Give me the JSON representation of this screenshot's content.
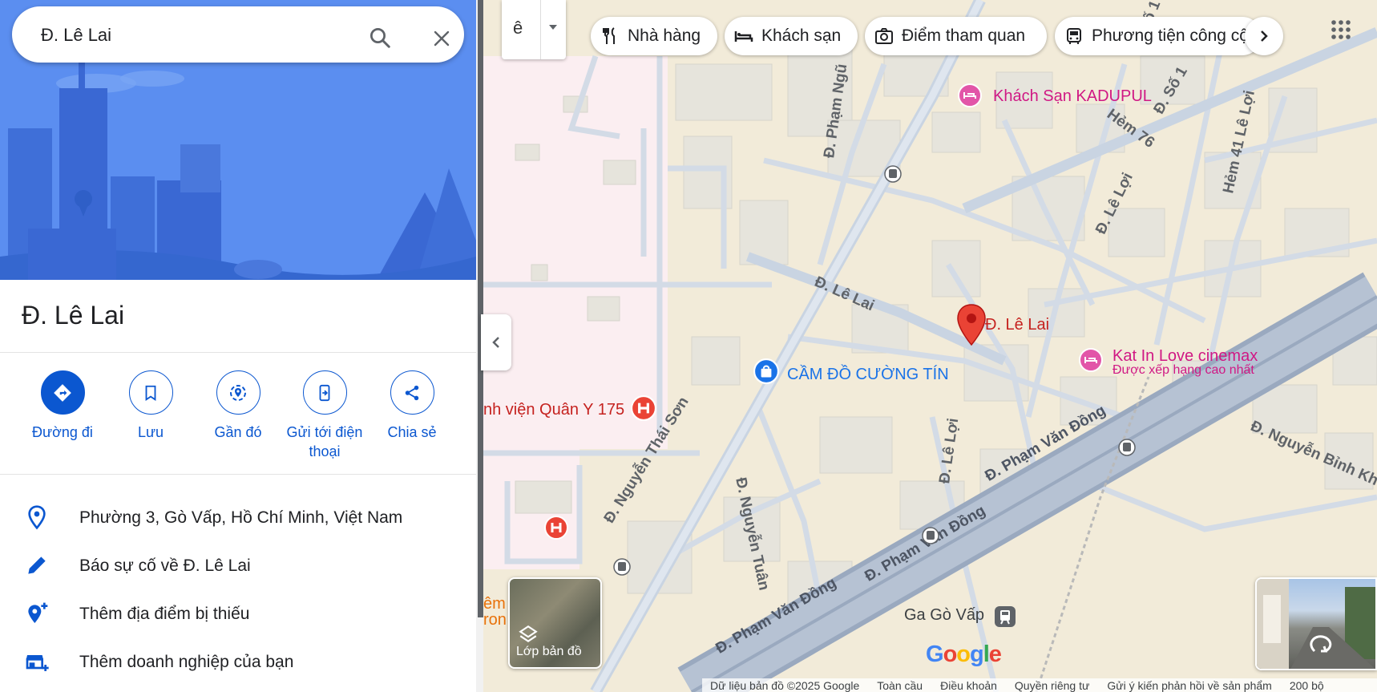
{
  "search": {
    "query": "Đ. Lê Lai"
  },
  "place": {
    "title": "Đ. Lê Lai",
    "actions": [
      {
        "label": "Đường đi",
        "icon": "directions-icon"
      },
      {
        "label": "Lưu",
        "icon": "bookmark-icon"
      },
      {
        "label": "Gần đó",
        "icon": "nearby-icon"
      },
      {
        "label": "Gửi tới điện thoại",
        "icon": "send-to-phone-icon"
      },
      {
        "label": "Chia sẻ",
        "icon": "share-icon"
      }
    ],
    "info": [
      {
        "text": "Phường 3, Gò Vấp, Hồ Chí Minh, Việt Nam",
        "icon": "location-pin-icon"
      },
      {
        "text": "Báo sự cố về Đ. Lê Lai",
        "icon": "edit-pencil-icon"
      },
      {
        "text": "Thêm địa điểm bị thiếu",
        "icon": "add-place-icon"
      },
      {
        "text": "Thêm doanh nghiệp của bạn",
        "icon": "add-business-icon"
      }
    ]
  },
  "map": {
    "transit_glyph": "ê",
    "chips": [
      {
        "label": "Nhà hàng",
        "icon": "restaurant-icon"
      },
      {
        "label": "Khách sạn",
        "icon": "hotel-icon"
      },
      {
        "label": "Điểm tham quan",
        "icon": "camera-icon"
      },
      {
        "label": "Phương tiện công cộng",
        "icon": "bus-icon"
      }
    ],
    "streets": {
      "le_lai_upper": "Đ. Lê Lai",
      "le_loi_upper": "Đ. Lê Lợi",
      "le_loi_lower": "Đ. Lê Lợi",
      "so1": "Đ. Số 1",
      "hem76": "Hẻm 76",
      "hem41": "Hẻm 41 Lê Lợi",
      "pham_ngu": "Đ. Phạm Ngũ",
      "nguyen_thai_son": "Đ. Nguyễn Thái Sơn",
      "nguyen_tuan": "Đ. Nguyễn Tuân",
      "pvd1": "Đ. Phạm Văn Đồng",
      "pvd2": "Đ. Phạm Văn Đồng",
      "pvd3": "Đ. Phạm Văn Đồng",
      "nguyen_binh_khiem": "Đ. Nguyễn Bỉnh Kh",
      "so_top": "Số 1"
    },
    "pois": {
      "selected": "Đ. Lê Lai",
      "khach_san": "Khách Sạn KADUPUL",
      "cinema": "Kat In Love cinemax",
      "cinema_sub": "Được xếp hạng cao nhất",
      "cam_do": "CẦM ĐỒ CƯỜNG TÍN",
      "hospital": "nh viện Quân Y 175",
      "station": "Ga Gò Vấp",
      "edge1": "êm",
      "edge2": "ron"
    },
    "layers_label": "Lớp bản đồ",
    "logo": "Google",
    "footer": {
      "data": "Dữ liệu bản đồ ©2025 Google",
      "global": "Toàn cầu",
      "terms": "Điều khoản",
      "privacy": "Quyền riêng tư",
      "feedback": "Gửi ý kiến phản hồi về sản phẩm",
      "scale": "200 bộ"
    }
  },
  "colors": {
    "accent": "#0b57d0",
    "hero": "#5b8eea",
    "pin": "#ea4335"
  }
}
